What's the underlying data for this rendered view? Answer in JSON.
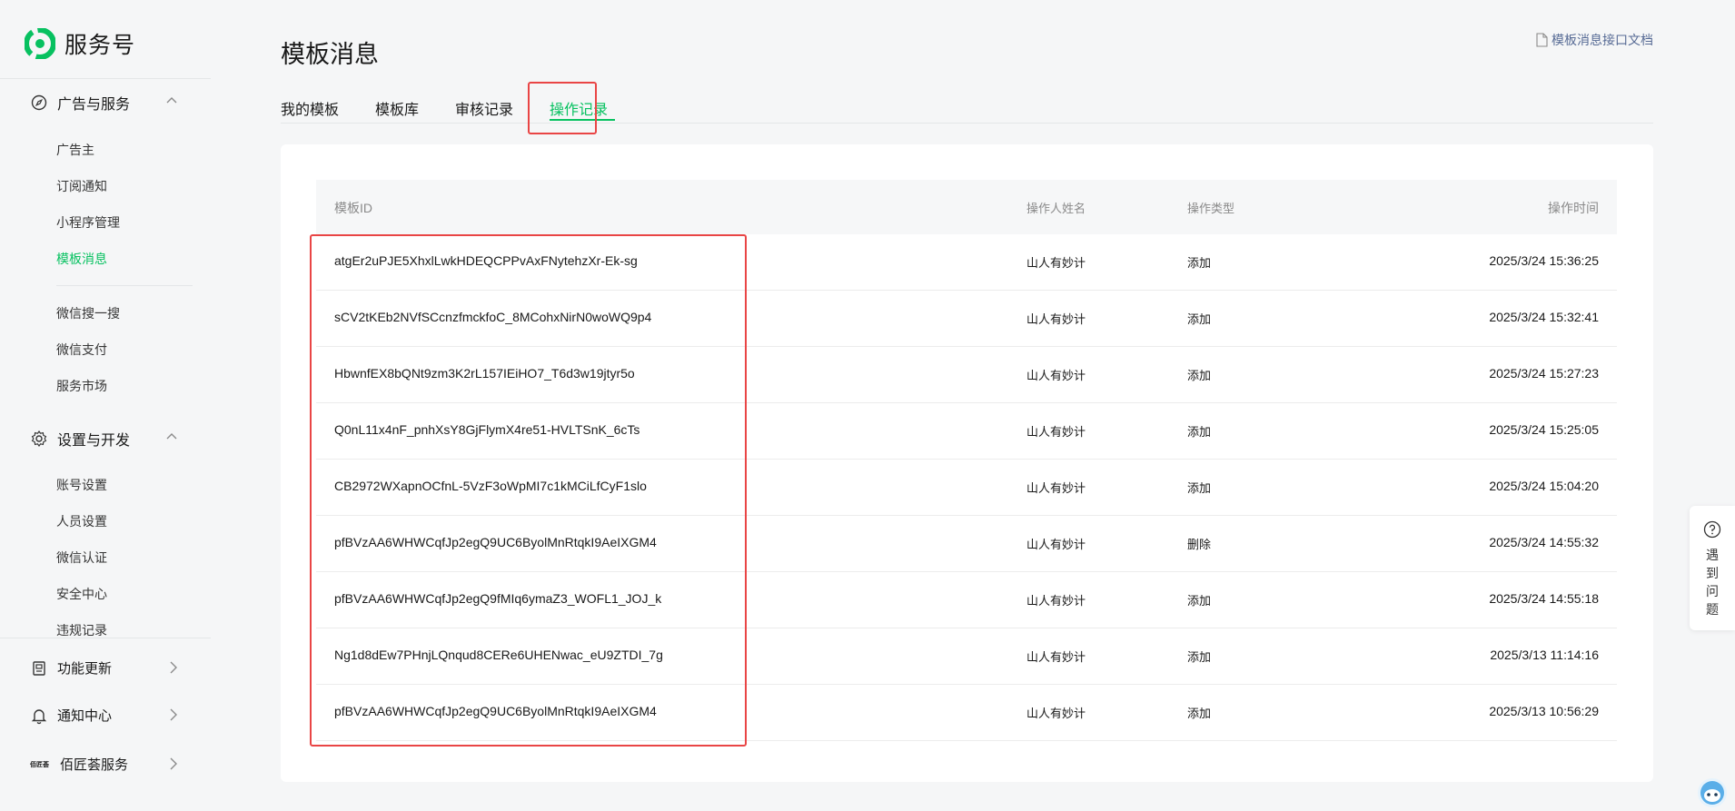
{
  "sidebar": {
    "brand": "服务号",
    "section1": {
      "label": "广告与服务",
      "items": [
        "广告主",
        "订阅通知",
        "小程序管理",
        "模板消息",
        "微信搜一搜",
        "微信支付",
        "服务市场"
      ]
    },
    "section2": {
      "label": "设置与开发",
      "items": [
        "账号设置",
        "人员设置",
        "微信认证",
        "安全中心",
        "违规记录"
      ]
    },
    "bottom": [
      "功能更新",
      "通知中心",
      "佰匠荟服务"
    ],
    "avatar_text": "佰匠荟"
  },
  "header": {
    "title": "模板消息",
    "doc_link": "模板消息接口文档"
  },
  "tabs": [
    "我的模板",
    "模板库",
    "审核记录",
    "操作记录"
  ],
  "table": {
    "headers": [
      "模板ID",
      "操作人姓名",
      "操作类型",
      "操作时间"
    ],
    "rows": [
      {
        "id": "atgEr2uPJE5XhxlLwkHDEQCPPvAxFNytehzXr-Ek-sg",
        "operator": "山人有妙计",
        "type": "添加",
        "time": "2025/3/24 15:36:25"
      },
      {
        "id": "sCV2tKEb2NVfSCcnzfmckfoC_8MCohxNirN0woWQ9p4",
        "operator": "山人有妙计",
        "type": "添加",
        "time": "2025/3/24 15:32:41"
      },
      {
        "id": "HbwnfEX8bQNt9zm3K2rL157IEiHO7_T6d3w19jtyr5o",
        "operator": "山人有妙计",
        "type": "添加",
        "time": "2025/3/24 15:27:23"
      },
      {
        "id": "Q0nL11x4nF_pnhXsY8GjFlymX4re51-HVLTSnK_6cTs",
        "operator": "山人有妙计",
        "type": "添加",
        "time": "2025/3/24 15:25:05"
      },
      {
        "id": "CB2972WXapnOCfnL-5VzF3oWpMI7c1kMCiLfCyF1slo",
        "operator": "山人有妙计",
        "type": "添加",
        "time": "2025/3/24 15:04:20"
      },
      {
        "id": "pfBVzAA6WHWCqfJp2egQ9UC6ByolMnRtqkI9AeIXGM4",
        "operator": "山人有妙计",
        "type": "删除",
        "time": "2025/3/24 14:55:32"
      },
      {
        "id": "pfBVzAA6WHWCqfJp2egQ9fMIq6ymaZ3_WOFL1_JOJ_k",
        "operator": "山人有妙计",
        "type": "添加",
        "time": "2025/3/24 14:55:18"
      },
      {
        "id": "Ng1d8dEw7PHnjLQnqud8CERe6UHENwac_eU9ZTDI_7g",
        "operator": "山人有妙计",
        "type": "添加",
        "time": "2025/3/13 11:14:16"
      },
      {
        "id": "pfBVzAA6WHWCqfJp2egQ9UC6ByolMnRtqkI9AeIXGM4",
        "operator": "山人有妙计",
        "type": "添加",
        "time": "2025/3/13 10:56:29"
      }
    ]
  },
  "help": {
    "label": "遇到问题"
  },
  "colors": {
    "accent": "#07c160",
    "highlight": "#e94545",
    "link": "#576b95"
  }
}
